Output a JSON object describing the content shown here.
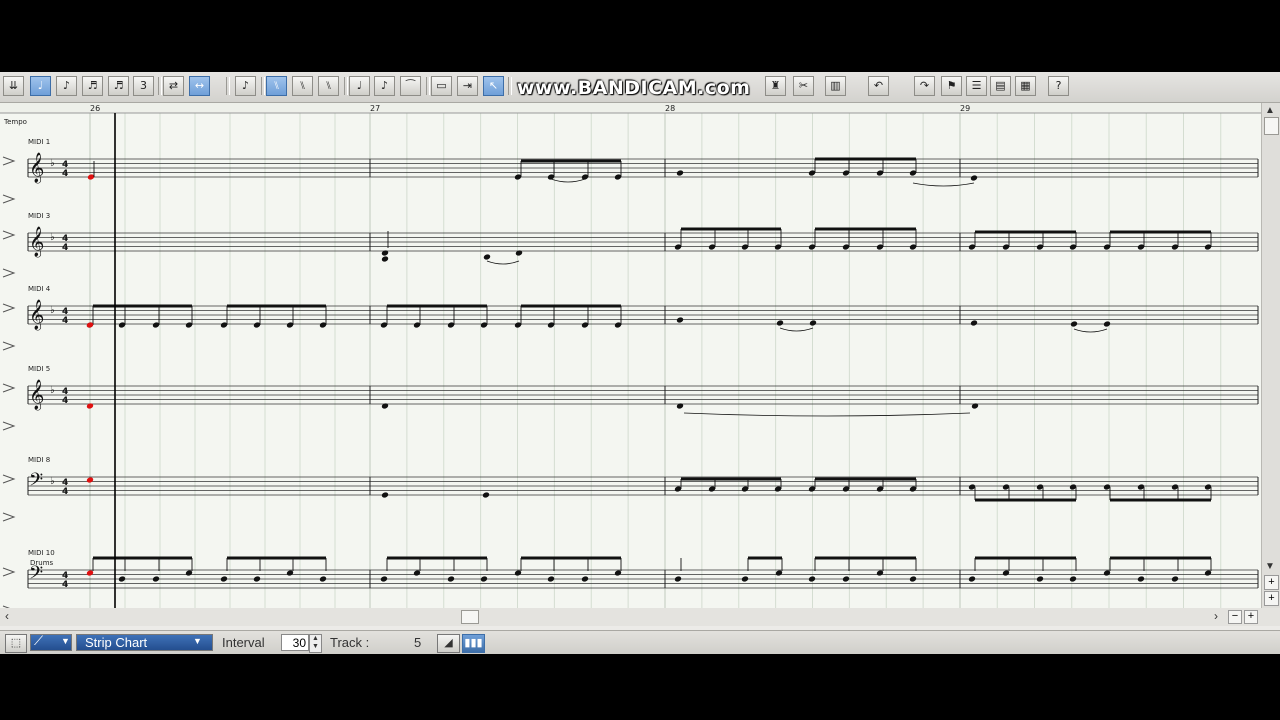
{
  "toolbar": {
    "tools": [
      {
        "name": "select-tool-icon",
        "glyph": "⇊"
      },
      {
        "name": "quarter-note-icon",
        "glyph": "♩",
        "active": true
      },
      {
        "name": "eighth-note-icon",
        "glyph": "♪"
      },
      {
        "name": "sixteenth-note-icon",
        "glyph": "♬"
      },
      {
        "name": "thirtysecond-note-icon",
        "glyph": "♬"
      },
      {
        "name": "triplet-icon",
        "glyph": "3"
      },
      {
        "name": "repeat-icon",
        "glyph": "⇄"
      },
      {
        "name": "fit-width-icon",
        "glyph": "↔",
        "active": true
      },
      {
        "name": "dotted-note-icon",
        "glyph": "♪"
      },
      {
        "name": "beam-1-icon",
        "glyph": "⑊",
        "active": true
      },
      {
        "name": "beam-2-icon",
        "glyph": "⑊"
      },
      {
        "name": "beam-3-icon",
        "glyph": "⑊"
      },
      {
        "name": "stem-down-icon",
        "glyph": "♩"
      },
      {
        "name": "stem-up-icon",
        "glyph": "♪"
      },
      {
        "name": "slur-icon",
        "glyph": "⁀"
      },
      {
        "name": "rest-box-icon",
        "glyph": "▭"
      },
      {
        "name": "step-input-icon",
        "glyph": "⇥"
      },
      {
        "name": "cursor-icon",
        "glyph": "↖",
        "active": true
      }
    ],
    "watermark": "www.BANDICAM.com"
  },
  "score": {
    "tempo_label": "Tempo",
    "measure_numbers": [
      "26",
      "27",
      "28",
      "29"
    ],
    "tracks": [
      {
        "label": "MIDI 1",
        "clef": "treble",
        "key": "b♭",
        "time_top": "4",
        "time_bottom": "4"
      },
      {
        "label": "MIDI 3",
        "clef": "treble",
        "key": "b♭",
        "time_top": "4",
        "time_bottom": "4"
      },
      {
        "label": "MIDI 4",
        "clef": "treble",
        "key": "b♭",
        "time_top": "4",
        "time_bottom": "4"
      },
      {
        "label": "MIDI 5",
        "clef": "treble",
        "key": "b♭",
        "time_top": "4",
        "time_bottom": "4"
      },
      {
        "label": "MIDI 8",
        "clef": "bass",
        "key": "b♭",
        "time_top": "4",
        "time_bottom": "4"
      },
      {
        "label": "MIDI 10",
        "sub": "Drums",
        "clef": "bass",
        "key": "",
        "time_top": "4",
        "time_bottom": "4"
      }
    ]
  },
  "statusbar": {
    "view_mode": "Strip Chart",
    "interval_label": "Interval",
    "interval_value": "30",
    "track_label": "Track  :",
    "track_value": "5"
  },
  "colors": {
    "accent": "#3d6ea8",
    "note": "#111111",
    "playhead_note": "#e01010",
    "grid": "#cfd9cc",
    "staff": "#222222"
  }
}
